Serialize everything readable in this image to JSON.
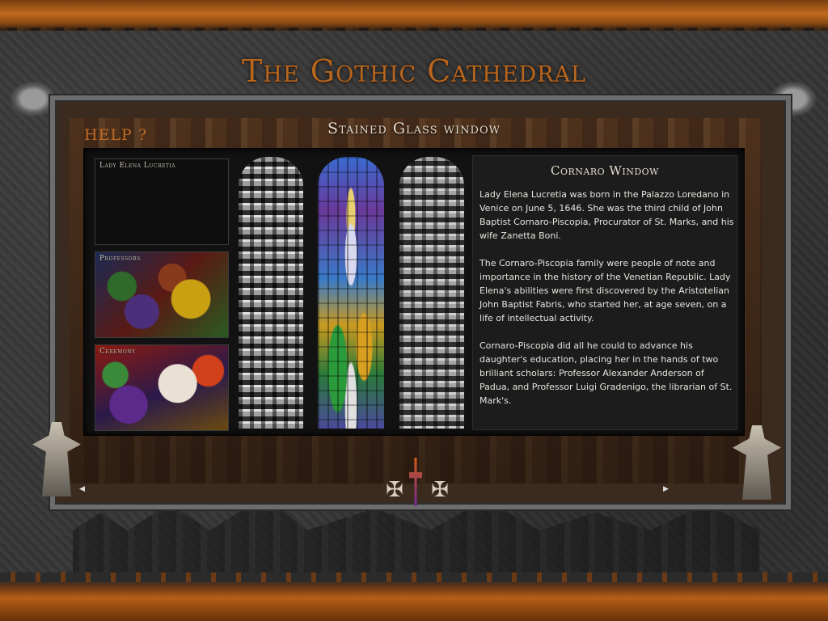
{
  "app": {
    "title": "The Gothic Cathedral"
  },
  "header": {
    "help_label": "HELP ?",
    "section_title": "Stained Glass window"
  },
  "thumbnails": [
    {
      "label": "Lady Elena Lucretia"
    },
    {
      "label": "Professors"
    },
    {
      "label": "Ceremony"
    }
  ],
  "windows": [
    {
      "icon": "stained-glass-left-icon"
    },
    {
      "icon": "stained-glass-center-icon"
    },
    {
      "icon": "stained-glass-right-icon"
    }
  ],
  "article": {
    "title": "Cornaro Window",
    "paragraphs": [
      "Lady Elena Lucretia was born in the Palazzo Loredano in Venice on June 5, 1646. She was the third child of John Baptist Cornaro-Piscopia, Procurator of St. Marks, and his wife Zanetta Boni.",
      "The Cornaro-Piscopia family were people of note and importance in the history of the Venetian Republic. Lady Elena's abilities were first discovered by the Aristotelian John Baptist Fabris, who started her, at age seven, on a life of intellectual activity.",
      "Cornaro-Piscopia did all he could to advance his daughter's education, placing her in the hands of two brilliant scholars: Professor Alexander Anderson of Padua, and Professor Luigi Gradenigo, the librarian of St. Mark's."
    ]
  },
  "ornaments": {
    "cross_glyph": "✠",
    "arrow_left_glyph": "◀",
    "arrow_right_glyph": "▶"
  },
  "colors": {
    "accent": "#b7661e",
    "rust": "#c06a1e",
    "panel": "#121212",
    "text": "#e8e4de"
  }
}
